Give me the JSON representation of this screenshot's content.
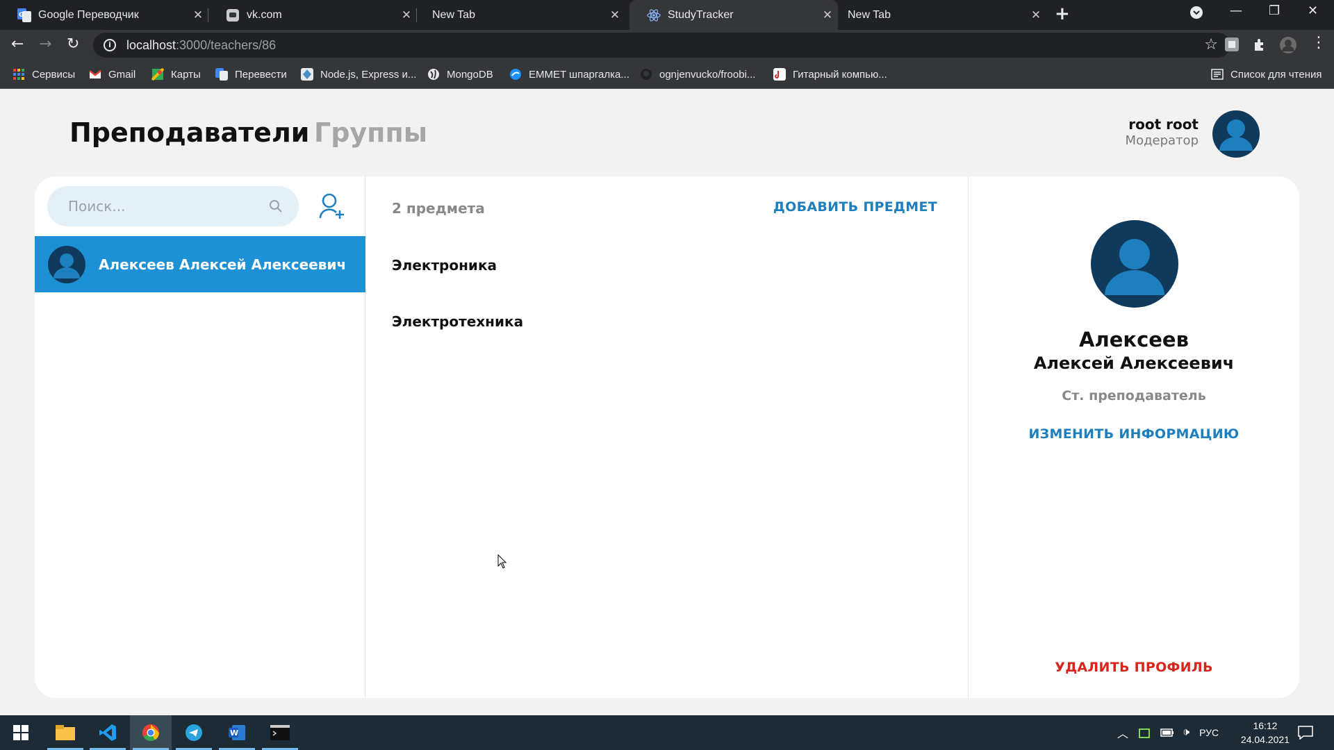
{
  "browser": {
    "tabs": [
      {
        "title": "Google Переводчик",
        "icon": "google-translate-icon"
      },
      {
        "title": "vk.com",
        "icon": "vk-icon"
      },
      {
        "title": "New Tab",
        "icon": ""
      },
      {
        "title": "StudyTracker",
        "icon": "react-icon",
        "active": true
      },
      {
        "title": "New Tab",
        "icon": ""
      }
    ],
    "url_host": "localhost",
    "url_path": ":3000/teachers/86",
    "bookmarks": [
      {
        "label": "Сервисы",
        "icon": "apps-grid-icon"
      },
      {
        "label": "Gmail",
        "icon": "gmail-icon"
      },
      {
        "label": "Карты",
        "icon": "maps-icon"
      },
      {
        "label": "Перевести",
        "icon": "translate-icon"
      },
      {
        "label": "Node.js, Express и...",
        "icon": "node-icon"
      },
      {
        "label": "MongoDB",
        "icon": "globe-icon"
      },
      {
        "label": "EMMET шпаргалка...",
        "icon": "emmet-icon"
      },
      {
        "label": "ognjenvucko/froobi...",
        "icon": "github-icon"
      },
      {
        "label": "Гитарный компью...",
        "icon": "guitar-icon"
      }
    ],
    "reading_list": "Список для чтения"
  },
  "app": {
    "nav": {
      "teachers": "Преподаватели",
      "groups": "Группы"
    },
    "user": {
      "name": "root root",
      "role": "Модератор"
    },
    "search": {
      "placeholder": "Поиск..."
    },
    "teachers": [
      {
        "name": "Алексеев Алексей Алексеевич",
        "selected": true
      }
    ],
    "subjects": {
      "count_label": "2 предмета",
      "add_label": "ДОБАВИТЬ ПРЕДМЕТ",
      "items": [
        "Электроника",
        "Электротехника"
      ]
    },
    "profile": {
      "last_name": "Алексеев",
      "first_middle": "Алексей Алексеевич",
      "position": "Ст. преподаватель",
      "edit_label": "ИЗМЕНИТЬ ИНФОРМАЦИЮ",
      "delete_label": "УДАЛИТЬ ПРОФИЛЬ"
    },
    "colors": {
      "accent": "#1e90d6",
      "avatar": "#103a5c",
      "danger": "#d9261c"
    }
  },
  "taskbar": {
    "apps": [
      "windows-start-icon",
      "file-explorer-icon",
      "vscode-icon",
      "chrome-icon",
      "telegram-icon",
      "word-icon",
      "terminal-icon"
    ],
    "language": "РУС",
    "time": "16:12",
    "date": "24.04.2021"
  }
}
